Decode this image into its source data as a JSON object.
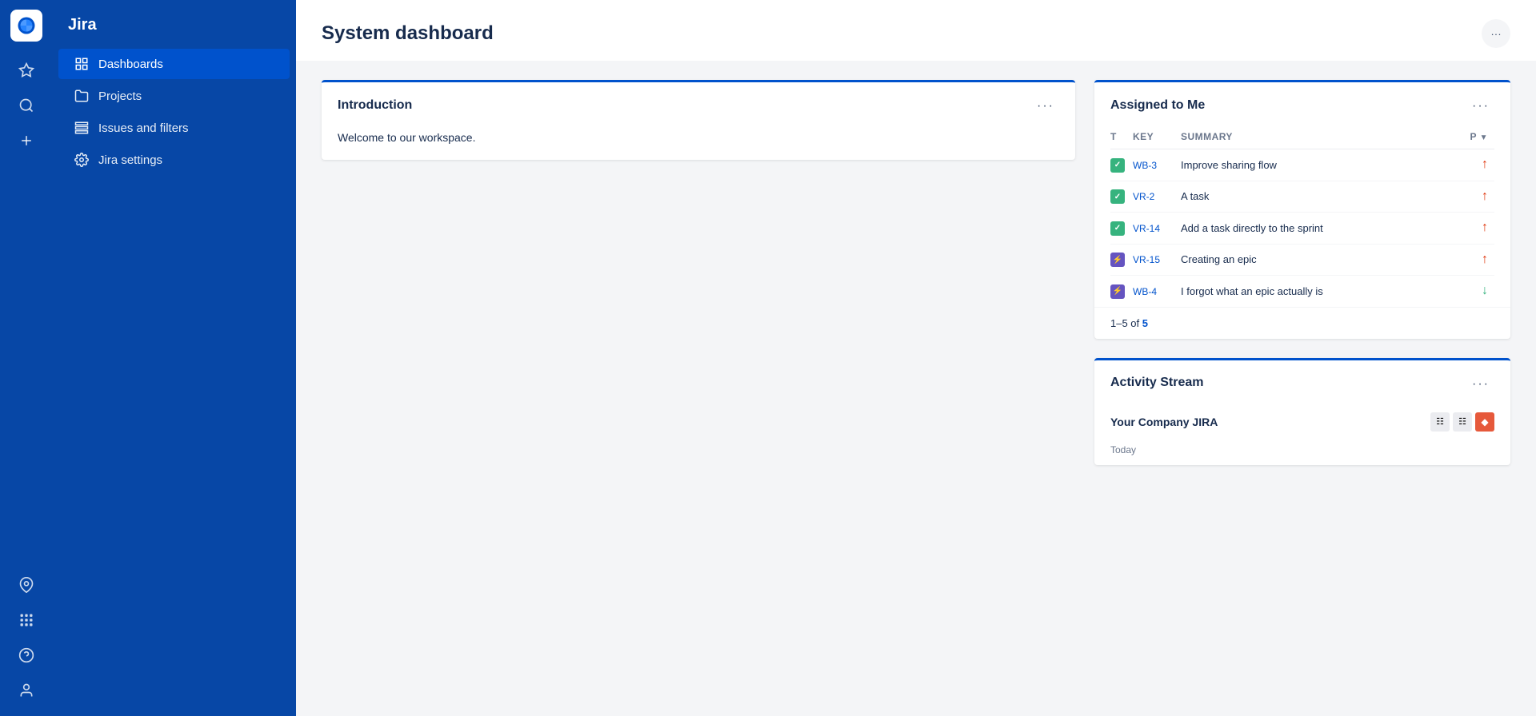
{
  "app": {
    "title": "Jira"
  },
  "iconRail": {
    "icons": [
      {
        "name": "star-icon",
        "label": "Favorites"
      },
      {
        "name": "search-icon",
        "label": "Search"
      },
      {
        "name": "create-icon",
        "label": "Create"
      },
      {
        "name": "pin-icon",
        "label": "Notifications"
      },
      {
        "name": "apps-icon",
        "label": "Apps"
      },
      {
        "name": "help-icon",
        "label": "Help"
      },
      {
        "name": "user-icon",
        "label": "Profile"
      }
    ]
  },
  "sidebar": {
    "title": "Jira",
    "items": [
      {
        "id": "dashboards",
        "label": "Dashboards",
        "active": true
      },
      {
        "id": "projects",
        "label": "Projects",
        "active": false
      },
      {
        "id": "issues-filters",
        "label": "Issues and filters",
        "active": false
      },
      {
        "id": "jira-settings",
        "label": "Jira settings",
        "active": false
      }
    ]
  },
  "page": {
    "title": "System dashboard",
    "more_label": "···"
  },
  "introduction": {
    "title": "Introduction",
    "more_label": "···",
    "body": "Welcome to our workspace."
  },
  "assigned_to_me": {
    "title": "Assigned to Me",
    "more_label": "···",
    "columns": {
      "t": "T",
      "key": "Key",
      "summary": "Summary",
      "priority": "P"
    },
    "rows": [
      {
        "type": "story",
        "key": "WB-3",
        "summary": "Improve sharing flow",
        "priority": "high"
      },
      {
        "type": "story",
        "key": "VR-2",
        "summary": "A task",
        "priority": "high"
      },
      {
        "type": "story",
        "key": "VR-14",
        "summary": "Add a task directly to the sprint",
        "priority": "high"
      },
      {
        "type": "epic",
        "key": "VR-15",
        "summary": "Creating an epic",
        "priority": "high"
      },
      {
        "type": "epic",
        "key": "WB-4",
        "summary": "I forgot what an epic actually is",
        "priority": "low"
      }
    ],
    "pagination": {
      "range": "1–5",
      "total_label": "of",
      "total": "5",
      "total_link": "5"
    }
  },
  "activity_stream": {
    "title": "Activity Stream",
    "more_label": "···",
    "company": "Your Company JIRA",
    "date": "Today"
  }
}
